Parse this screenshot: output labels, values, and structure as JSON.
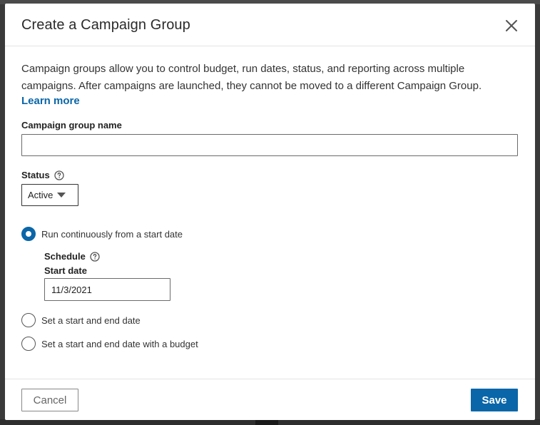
{
  "modal": {
    "title": "Create a Campaign Group",
    "close_icon": "close-icon",
    "description": "Campaign groups allow you to control budget, run dates, status, and reporting across multiple campaigns. After campaigns are launched, they cannot be moved to a different Campaign Group.",
    "learn_more": "Learn more"
  },
  "form": {
    "name_label": "Campaign group name",
    "name_value": "",
    "status_label": "Status",
    "status_value": "Active",
    "radios": [
      {
        "label": "Run continuously from a start date",
        "checked": true
      },
      {
        "label": "Set a start and end date",
        "checked": false
      },
      {
        "label": "Set a start and end date with a budget",
        "checked": false
      }
    ],
    "schedule_label": "Schedule",
    "start_date_label": "Start date",
    "start_date_value": "11/3/2021"
  },
  "footer": {
    "cancel_label": "Cancel",
    "save_label": "Save"
  },
  "colors": {
    "accent": "#0a66a8"
  }
}
